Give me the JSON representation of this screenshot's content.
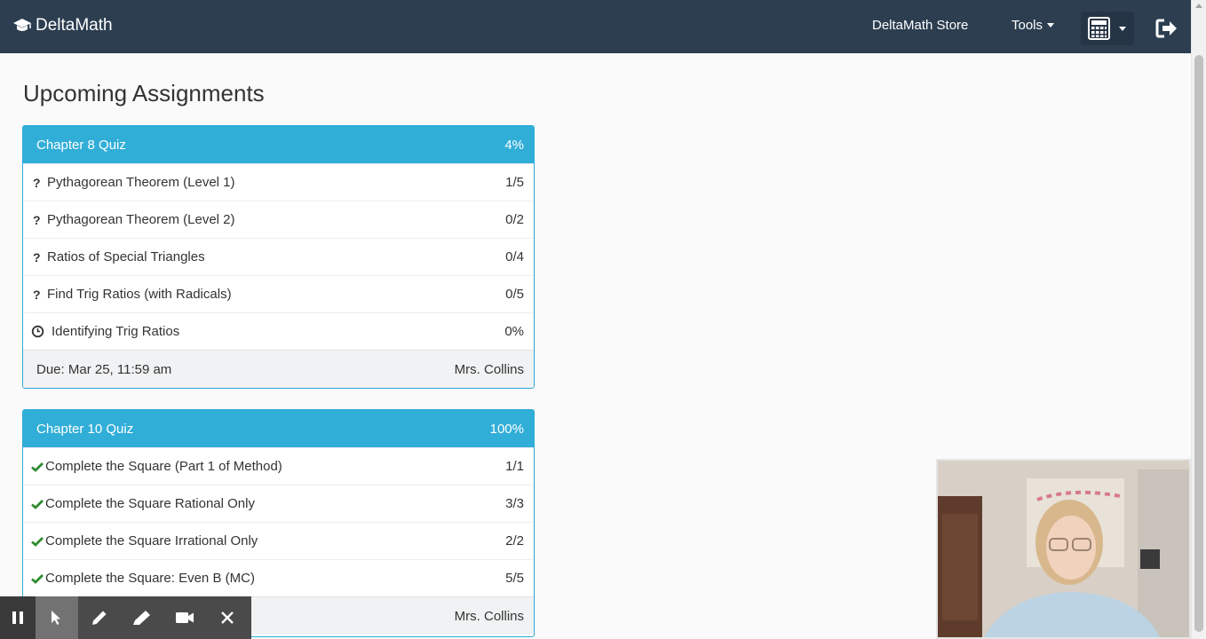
{
  "navbar": {
    "brand": "DeltaMath",
    "store_label": "DeltaMath Store",
    "tools_label": "Tools"
  },
  "page": {
    "title": "Upcoming Assignments"
  },
  "assignments": [
    {
      "title": "Chapter 8 Quiz",
      "percent": "4%",
      "items": [
        {
          "status": "question",
          "name": "Pythagorean Theorem (Level 1)",
          "score": "1/5"
        },
        {
          "status": "question",
          "name": "Pythagorean Theorem (Level 2)",
          "score": "0/2"
        },
        {
          "status": "question",
          "name": "Ratios of Special Triangles",
          "score": "0/4"
        },
        {
          "status": "question",
          "name": "Find Trig Ratios (with Radicals)",
          "score": "0/5"
        },
        {
          "status": "timed",
          "name": "Identifying Trig Ratios",
          "score": "0%"
        }
      ],
      "due": "Due: Mar 25, 11:59 am",
      "teacher": "Mrs. Collins"
    },
    {
      "title": "Chapter 10 Quiz",
      "percent": "100%",
      "items": [
        {
          "status": "complete",
          "name": "Complete the Square (Part 1 of Method)",
          "score": "1/1"
        },
        {
          "status": "complete",
          "name": "Complete the Square Rational Only",
          "score": "3/3"
        },
        {
          "status": "complete",
          "name": "Complete the Square Irrational Only",
          "score": "2/2"
        },
        {
          "status": "complete",
          "name": "Complete the Square: Even B (MC)",
          "score": "5/5"
        }
      ],
      "teacher": "Mrs. Collins"
    }
  ],
  "icons": {
    "brand": "graduation-cap-icon",
    "calculator": "calculator-icon",
    "logout": "sign-out-icon",
    "question": "question-mark-icon",
    "timed": "clock-icon",
    "complete": "checkmark-icon",
    "toolbar": [
      "pause-icon",
      "cursor-icon",
      "pencil-icon",
      "highlighter-icon",
      "video-camera-icon",
      "close-icon"
    ]
  },
  "colors": {
    "navbar": "#2c3e50",
    "panel_heading": "#31aed8",
    "check": "#2e8b2e"
  }
}
